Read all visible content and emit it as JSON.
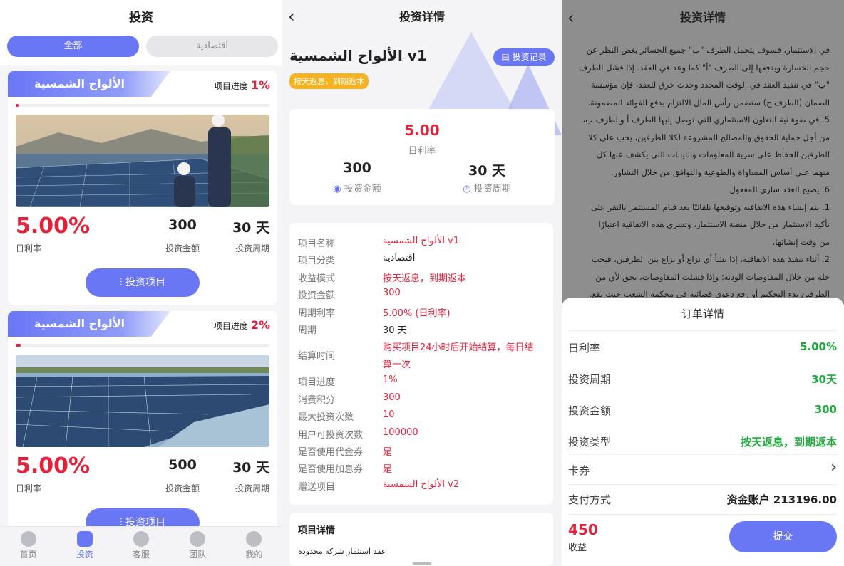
{
  "list": {
    "title": "投资",
    "tabs": [
      "全部",
      "اقتصادية"
    ],
    "progress_label": "项目进度",
    "rate_label": "日利率",
    "amount_label": "投资金额",
    "period_label": "投资周期",
    "button_label": "投资项目",
    "cards": [
      {
        "title": "الألواح الشمسية v1",
        "progress": "1%",
        "progress_value": 1,
        "rate": "5.00%",
        "amount": "300",
        "period": "30 天"
      },
      {
        "title": "الألواح الشمسية v2",
        "progress": "2%",
        "progress_value": 2,
        "rate": "5.00%",
        "amount": "500",
        "period": "30 天"
      }
    ],
    "tabbar": [
      {
        "label": "首页",
        "icon": "home-icon",
        "active": false
      },
      {
        "label": "投资",
        "icon": "invest-icon",
        "active": true
      },
      {
        "label": "客服",
        "icon": "service-icon",
        "active": false
      },
      {
        "label": "团队",
        "icon": "team-icon",
        "active": false
      },
      {
        "label": "我的",
        "icon": "user-icon",
        "active": false
      }
    ]
  },
  "detail": {
    "header": "投资详情",
    "back": "‹",
    "title": "الألواح الشمسية v1",
    "tag": "按天返息，到期返本",
    "record_button": "投资记录",
    "summary": {
      "rate": "5.00",
      "rate_label": "日利率",
      "amount": "300",
      "amount_label": "投资金额",
      "period": "30 天",
      "period_label": "投资周期"
    },
    "fields": [
      {
        "k": "项目名称",
        "v": "الألواح الشمسية v1",
        "red": true
      },
      {
        "k": "项目分类",
        "v": "اقتصادية",
        "red": false
      },
      {
        "k": "收益模式",
        "v": "按天返息，到期返本",
        "red": true
      },
      {
        "k": "投资金额",
        "v": "300",
        "red": true
      },
      {
        "k": "周期利率",
        "v": "5.00% (日利率)",
        "red": true
      },
      {
        "k": "周期",
        "v": "30 天",
        "red": false
      },
      {
        "k": "结算时间",
        "v": "购买项目24小时后开始结算，每日结",
        "v2": "算一次",
        "red": true
      },
      {
        "k": "项目进度",
        "v": "1%",
        "red": true
      },
      {
        "k": "消费积分",
        "v": "300",
        "red": true
      },
      {
        "k": "最大投资次数",
        "v": "10",
        "red": true
      },
      {
        "k": "用户可投资次数",
        "v": "100000",
        "red": true
      },
      {
        "k": "是否使用代金券",
        "v": "是",
        "red": true
      },
      {
        "k": "是否使用加息券",
        "v": "是",
        "red": true
      },
      {
        "k": "赠送项目",
        "v": "الألواح الشمسية v2",
        "red": true
      }
    ],
    "project_detail_title": "项目详情",
    "project_detail_text": "عقد استثمار شركة محدودة"
  },
  "order": {
    "header": "投资详情",
    "back": "‹",
    "contract_lines": [
      "في الاستثمار، فسوف يتحمل الطرف \"ب\" جميع الخسائر بغض النظر عن",
      "حجم الخسارة ويدفعها إلى الطرف \"أ\" كما وعد في العقد. إذا فشل الطرف",
      "\"ب\" في تنفيذ العقد في الوقت المحدد وحدث خرق للعقد، فإن مؤسسة",
      "الضمان (الطرف ج) ستضمن رأس المال الالتزام بدفع الفوائد المضمونة.",
      "5. في ضوء نية التعاون الاستثماري التي توصل إليها الطرف أ والطرف ب،",
      "من أجل حماية الحقوق والمصالح المشروعة لكلا الطرفين، يجب على كلا",
      "الطرفين الحفاظ على سرية المعلومات والبيانات التي يكشف عنها كل",
      "منهما على أساس المساواة والطوعية والتوافق من خلال التشاور.",
      "6. يصبح العقد ساري المفعول",
      "1. يتم إنشاء هذه الاتفاقية وتوقيعها تلقائيًا بعد قيام المستثمر بالنقر على",
      "تأكيد الاستثمار من خلال منصة الاستثمار، وتسري هذه الاتفاقية اعتبارًا",
      "من وقت إنشائها.",
      "2. أثناء تنفيذ هذه الاتفاقية، إذا نشأ أي نزاع أو نزاع بين الطرفين، فيجب",
      "حله من خلال المفاوضات الودية؛ وإذا فشلت المفاوضات، يحق لأي من",
      "الطرفين بدء التحكيم أو رفع دعوى قضائية في محكمة الشعب حيث يقع."
    ],
    "sheet_title": "订单详情",
    "rows": [
      {
        "k": "日利率",
        "v": "5.00%"
      },
      {
        "k": "投资周期",
        "v": "30天"
      },
      {
        "k": "投资金额",
        "v": "300"
      },
      {
        "k": "投资类型",
        "v": "按天返息，到期返本"
      }
    ],
    "coupon_label": "卡券",
    "coupon_arrow": "›",
    "pay_label": "支付方式",
    "pay_value": "资金账户 213196.00",
    "income_value": "450",
    "income_label": "收益",
    "submit_label": "提交"
  }
}
